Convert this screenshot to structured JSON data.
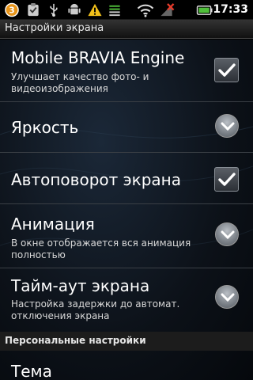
{
  "status_bar": {
    "time": "17:33",
    "notification_count": "3",
    "icons": [
      "notification-count-icon",
      "clipboard-check-icon",
      "usb-icon",
      "android-debug-icon",
      "warning-icon",
      "signal-bars-icon",
      "wifi-icon",
      "no-signal-icon",
      "battery-icon"
    ]
  },
  "titlebar": {
    "title": "Настройки экрана"
  },
  "settings": [
    {
      "title": "Mobile BRAVIA Engine",
      "summary": "Улучшает качество фото- и видеоизображения",
      "control": "checkbox",
      "checked": true
    },
    {
      "title": "Яркость",
      "summary": "",
      "control": "chevron"
    },
    {
      "title": "Автоповорот экрана",
      "summary": "",
      "control": "checkbox",
      "checked": true
    },
    {
      "title": "Анимация",
      "summary": "В окне отображается вся анимация полностью",
      "control": "chevron"
    },
    {
      "title": "Тайм-аут экрана",
      "summary": "Настройка задержки до автомат. отключения экрана",
      "control": "chevron"
    }
  ],
  "section": {
    "title": "Персональные настройки"
  },
  "partial_item": {
    "title": "Тема"
  }
}
